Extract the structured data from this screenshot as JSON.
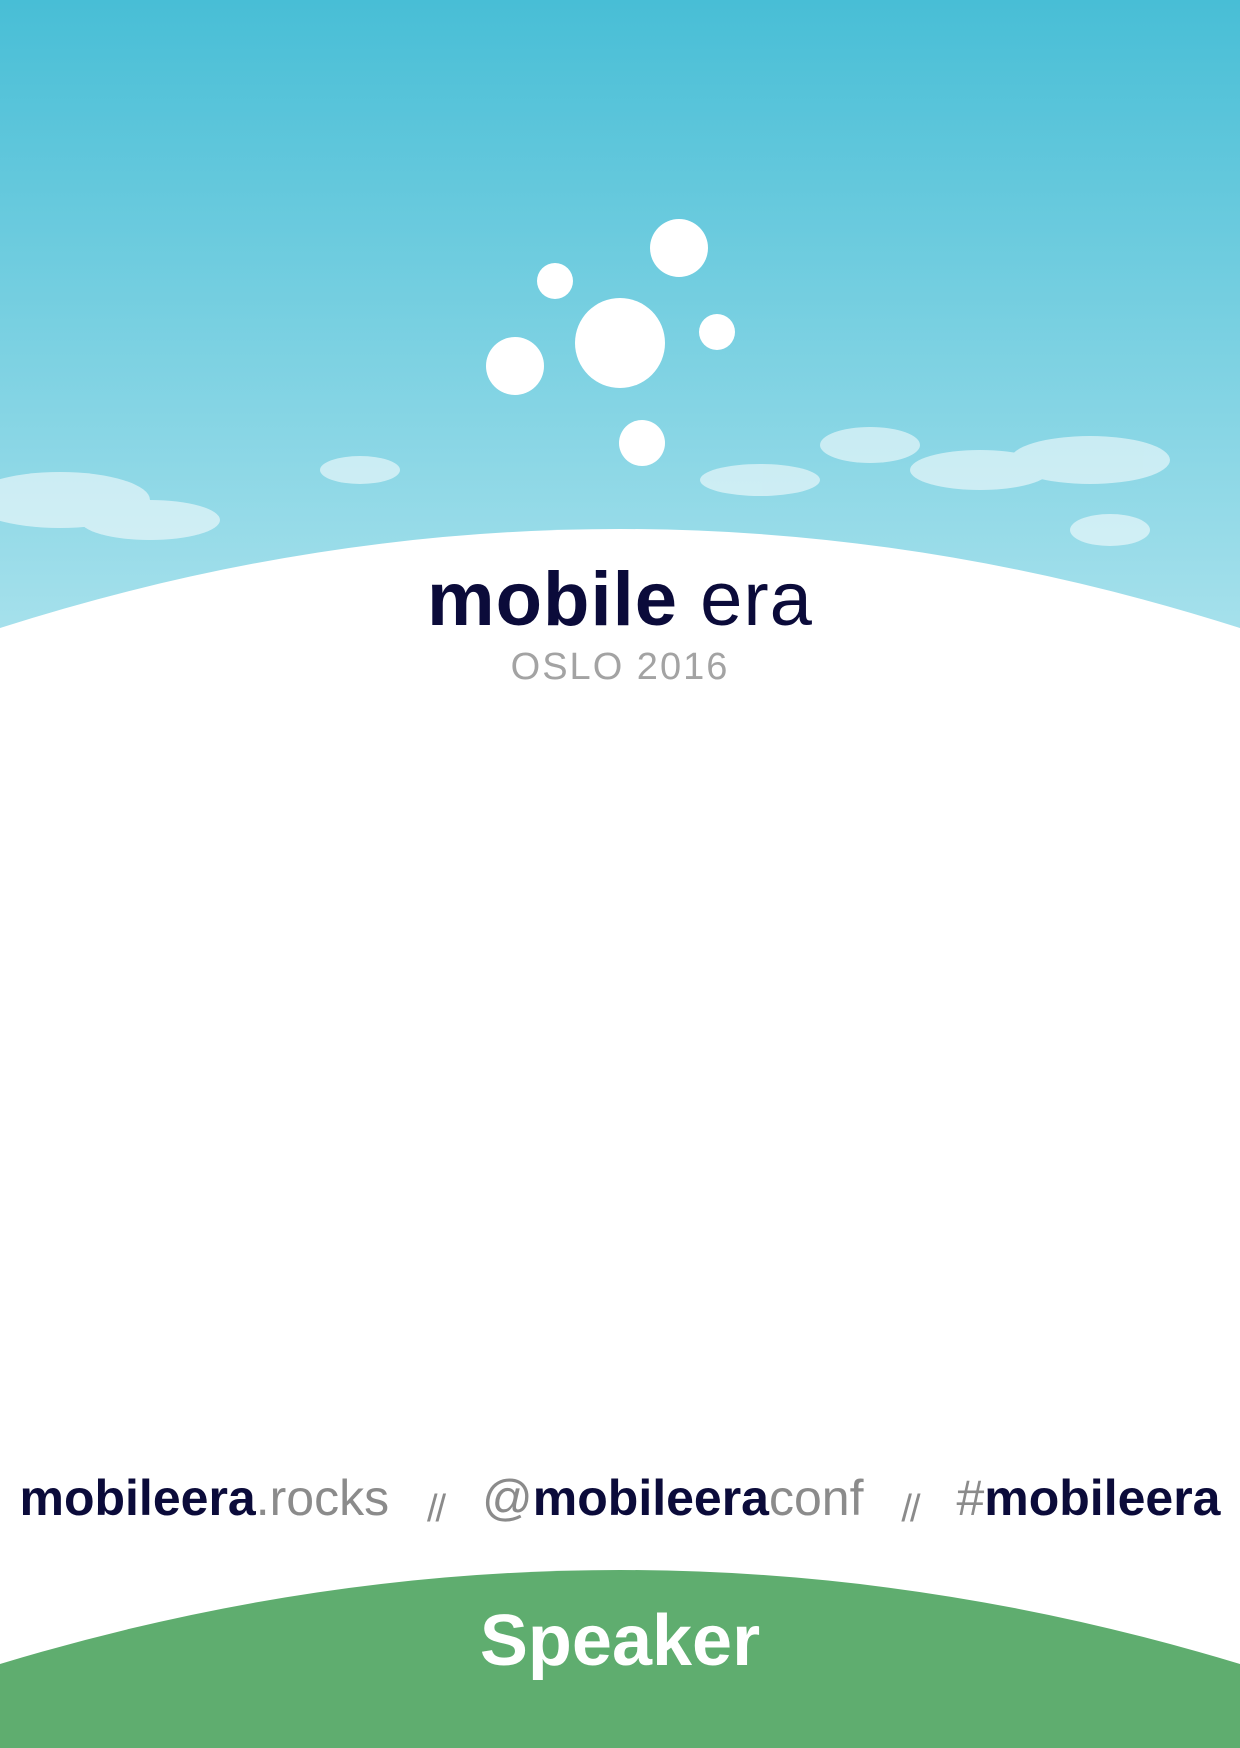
{
  "colors": {
    "sky_top": "#48bed6",
    "sky_bottom": "#a7e1ec",
    "navy": "#0b0b3a",
    "grey": "#8b8b8b",
    "footer_green": "#5fad6f",
    "white": "#ffffff"
  },
  "logo": {
    "icon": "bubbles-logo-icon"
  },
  "brand": {
    "name_bold": "mobile",
    "name_light": " era",
    "subtitle": "OSLO 2016"
  },
  "links": {
    "site_main": "mobileera",
    "site_suffix": ".rocks",
    "separator": "//",
    "handle_at": "@",
    "handle_main": "mobileera",
    "handle_suffix": "conf",
    "hashtag_symbol": "#",
    "hashtag_main": "mobileera"
  },
  "footer": {
    "role": "Speaker"
  }
}
